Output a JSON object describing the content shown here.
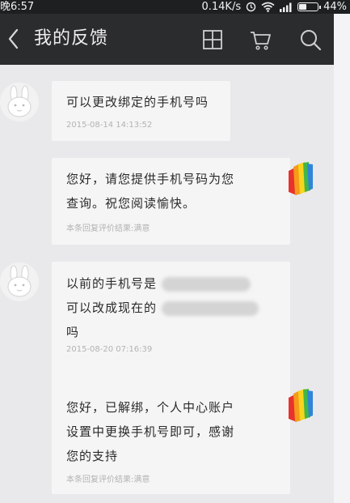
{
  "status": {
    "time": "晚6:57",
    "speed": "0.14K/s",
    "battery": "44%",
    "battery_level": 0.44
  },
  "header": {
    "title": "我的反馈"
  },
  "messages": [
    {
      "side": "user",
      "text": "可以更改绑定的手机号吗",
      "meta": "2015-08-14 14:13:52"
    },
    {
      "side": "service",
      "text_lines": [
        "您好，请您提供手机号码为您",
        "查询。祝您阅读愉快。"
      ],
      "meta": "本条回复评价结果:满意"
    },
    {
      "side": "user",
      "text_lines": [
        "以前的手机号是",
        "可以改成现在的",
        "吗"
      ],
      "meta": "2015-08-20 07:16:39"
    },
    {
      "side": "service",
      "text_lines": [
        "您好，已解绑，个人中心账户",
        "设置中更换手机号即可，感谢",
        "您的支持"
      ],
      "meta": "本条回复评价结果:满意"
    }
  ],
  "colors": {
    "header_bg": "#2b2c2e",
    "statusbar_bg": "#1d1f21",
    "chat_bg": "#e9e9eb",
    "bubble_bg": "#f5f5f5"
  },
  "icons": {
    "back": "chevron-left-icon",
    "grid": "grid-icon",
    "cart": "cart-icon",
    "search": "search-icon",
    "user_avatar": "rabbit-avatar-icon",
    "service_avatar": "book-logo-icon"
  }
}
